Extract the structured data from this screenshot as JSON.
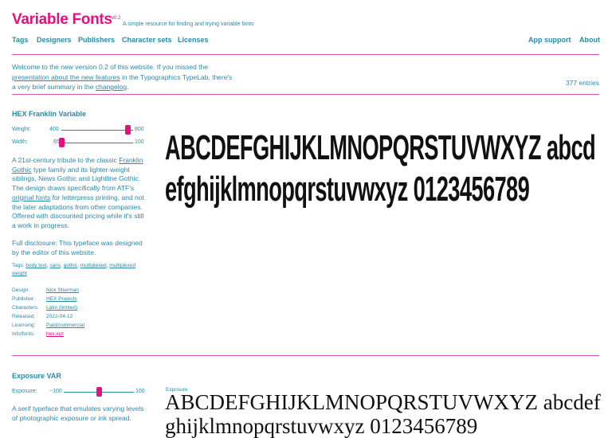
{
  "header": {
    "title": "Variable Fonts",
    "version": "v0.2",
    "tagline": "A simple resource for finding and trying variable fonts",
    "nav_left": [
      "Tags",
      "Designers",
      "Publishers",
      "Character sets",
      "Licenses"
    ],
    "nav_right": [
      "App support",
      "About"
    ]
  },
  "intro": {
    "text1": "Welcome to the new version 0.2 of this website. If you missed the ",
    "link1": "presentation about the new features",
    "text2": " in the Typographics TypeLab, there's a very brief summary in the ",
    "link2": "changelog",
    "text3": ".",
    "count": "377 entries"
  },
  "entries": [
    {
      "name": "HEX Franklin Variable",
      "sliders": [
        {
          "label": "Weight:",
          "min": "400",
          "max": "800",
          "value_fraction": 0.92
        },
        {
          "label": "Width:",
          "min": "65",
          "max": "100",
          "value_fraction": 0.0
        }
      ],
      "desc1_a": "A 21st-century tribute to the classic ",
      "desc1_link1": "Franklin Gothic",
      "desc1_b": " type family and its lighter-weight siblings, News Gothic and Lightline Gothic. The design draws specifically from ATF's ",
      "desc1_link2": "original fonts",
      "desc1_c": " for letterpress printing, and not the later adaptations from other companies. Offered with discounted pricing while it's still a work in progress.",
      "desc2": "Full disclosure: This typeface was designed by the editor of this website.",
      "tags_label": "Tags:",
      "tags": [
        "body text",
        "sans",
        "gothic",
        "multiplexed",
        "multiplexed weight"
      ],
      "meta": [
        {
          "k": "Design:",
          "v": "Nick Sherman"
        },
        {
          "k": "Publisher:",
          "v": "HEX Projects"
        },
        {
          "k": "Characters:",
          "v": "Latin (limited)"
        },
        {
          "k": "Released:",
          "v": "2022-04-12"
        },
        {
          "k": "Licensing:",
          "v": "Paid/commercial"
        },
        {
          "k": "Info/fonts:",
          "v": "hex.xyz"
        }
      ],
      "specimen": "ABCDEFGHIJKLMNOPQRSTUVWXYZ abcdefghijklmnopqrstuvwxyz 0123456789"
    },
    {
      "name": "Exposure VAR",
      "sliders": [
        {
          "label": "Exposure:",
          "min": "−100",
          "max": "100",
          "value_fraction": 0.5
        }
      ],
      "desc1": "A serif typeface that emulates varying levels of photographic exposure or ink spread.",
      "specimen_label": "Exposure",
      "specimen": "ABCDEFGHIJKLMNOPQRSTUVWXYZ abcdefghijklmnopqrstuvwxyz 0123456789"
    }
  ],
  "colors": {
    "accent": "#e0127e",
    "link": "#2a8aa6",
    "rule": "#d45bb0"
  }
}
